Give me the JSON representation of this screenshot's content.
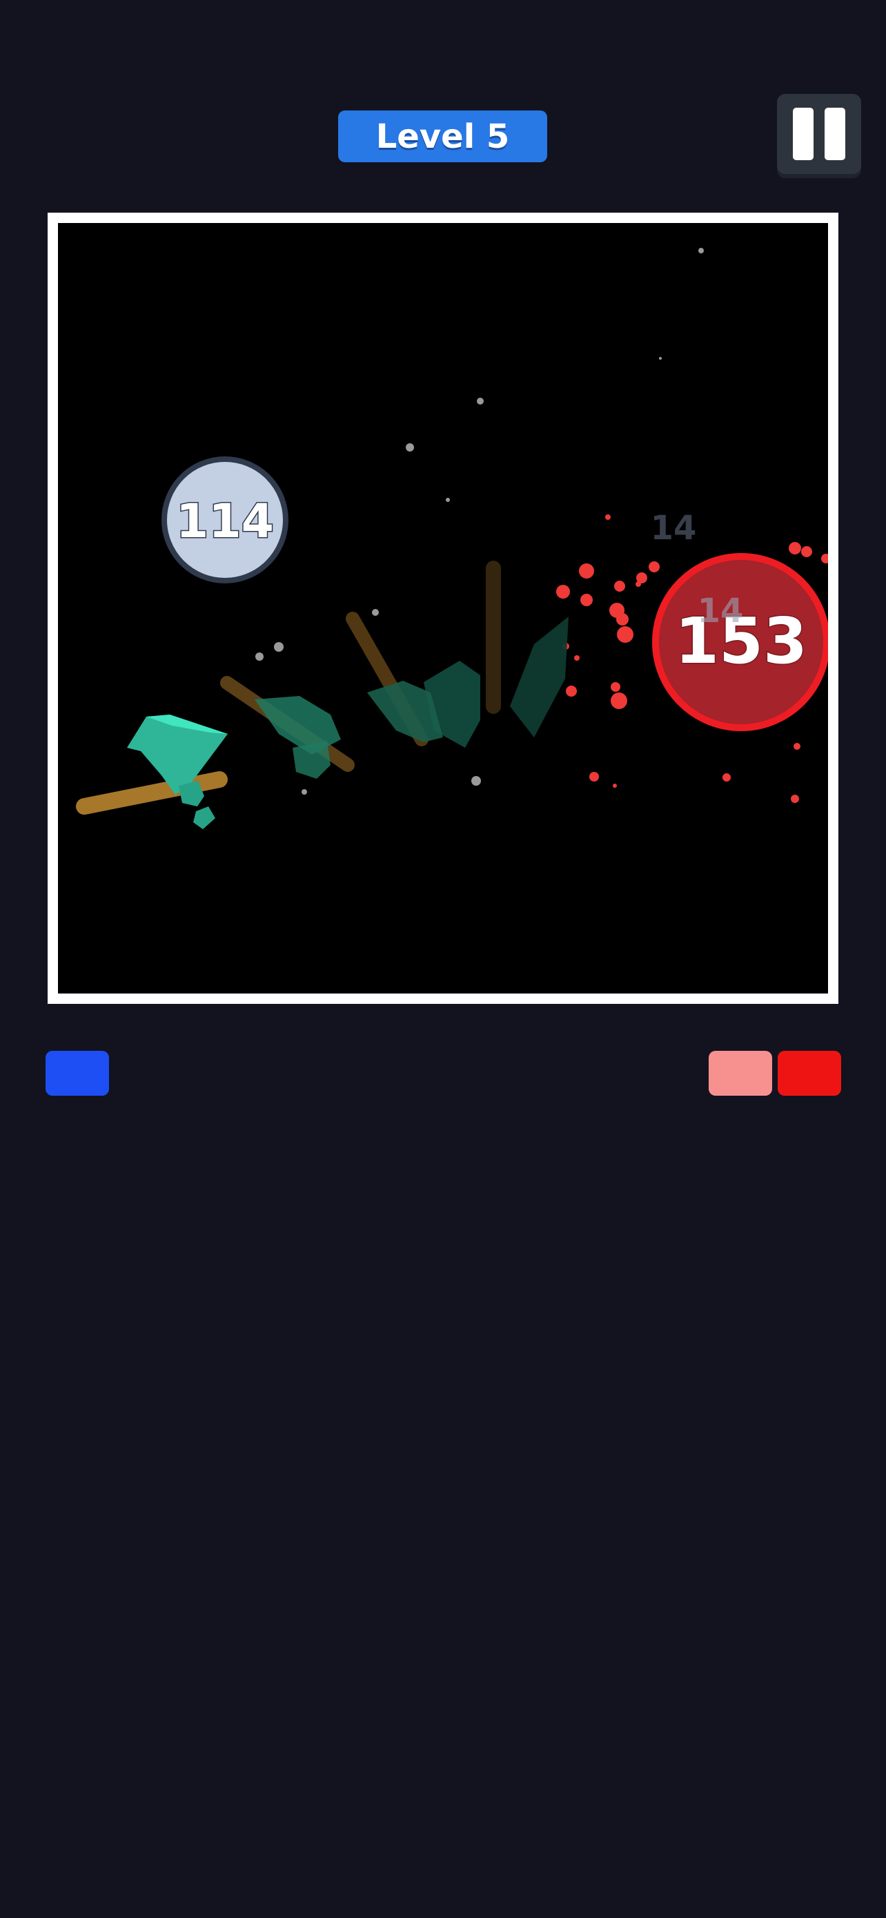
{
  "header": {
    "level_label": "Level 5"
  },
  "pause": {
    "icon": "pause-icon"
  },
  "arena": {
    "player": {
      "hp": "114",
      "color": "#c3cfe2",
      "border_color": "#2f3a4c"
    },
    "enemy": {
      "hp": "153",
      "color": "#a5232b",
      "border_color": "#ee1d23"
    },
    "damage_numbers": [
      {
        "value": "14"
      },
      {
        "value": "14"
      }
    ],
    "weapon": {
      "type": "axe-icon",
      "head_color": "#39d6b0",
      "handle_color": "#a7772a"
    },
    "effects_color": "#ef3a37"
  },
  "teams": {
    "left": [
      {
        "color": "#1e4ff5"
      }
    ],
    "right": [
      {
        "color": "#f79190"
      },
      {
        "color": "#ef1414"
      }
    ]
  }
}
